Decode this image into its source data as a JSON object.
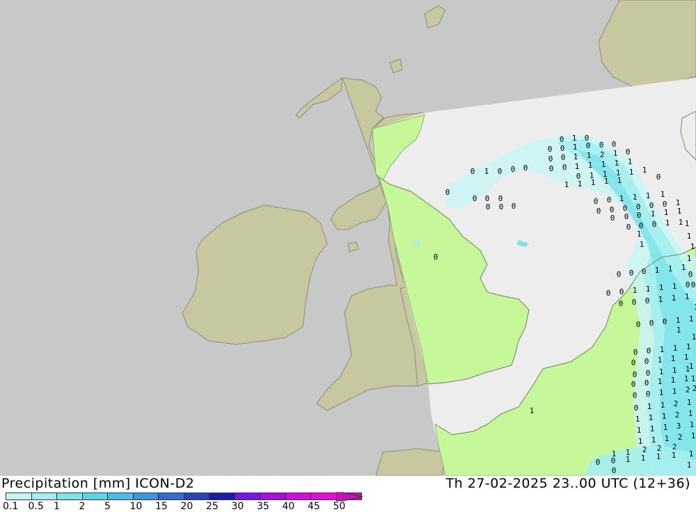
{
  "header": {
    "title_left": "Precipitation [mm] ICON-D2",
    "title_right": "Th 27-02-2025 23..00 UTC (12+36)"
  },
  "legend": {
    "labels": [
      "0.1",
      "0.5",
      "1",
      "2",
      "5",
      "10",
      "15",
      "20",
      "25",
      "30",
      "35",
      "40",
      "45",
      "50"
    ],
    "colors": [
      "#c8f4f4",
      "#a4eef0",
      "#7de4ea",
      "#5cd6e4",
      "#4cbde6",
      "#3c96de",
      "#2f6cd4",
      "#2744bc",
      "#1c1ca8",
      "#7a14e8",
      "#a80ce0",
      "#d60ae0",
      "#e80cd8",
      "#c414b4"
    ]
  },
  "colors": {
    "outside_domain": "#c8c8c8",
    "model_land": "#c8c8a0",
    "model_sea": "#ededed",
    "model_land_green": "#c6f89a",
    "precip_light": "#a4eef0",
    "precip_medium": "#7de4ea"
  },
  "map": {
    "values": [
      "0",
      "1",
      "0",
      "0",
      "0",
      "1",
      "0",
      "0",
      "0",
      "0",
      "0",
      "1",
      "1",
      "2",
      "1",
      "0",
      "0",
      "0",
      "1",
      "1",
      "1",
      "1",
      "1",
      "0",
      "1",
      "0",
      "0",
      "0",
      "0",
      "1",
      "1",
      "1",
      "1",
      "1",
      "0",
      "0",
      "0",
      "0",
      "1",
      "1",
      "1",
      "1",
      "1",
      "0",
      "0",
      "0",
      "0",
      "0",
      "0",
      "1",
      "1",
      "1",
      "1",
      "0",
      "0",
      "0",
      "0",
      "0",
      "0",
      "1",
      "1",
      "1",
      "1",
      "0",
      "0",
      "0",
      "1",
      "1",
      "1",
      "1",
      "0",
      "0",
      "0",
      "1",
      "1",
      "1",
      "1",
      "0",
      "0",
      "0",
      "1",
      "1",
      "1",
      "0",
      "0",
      "0",
      "0",
      "1",
      "1",
      "1",
      "1",
      "0",
      "0",
      "0",
      "0",
      "1",
      "1",
      "1",
      "0",
      "0",
      "0",
      "0",
      "1",
      "1",
      "1",
      "1",
      "0",
      "0",
      "1",
      "1",
      "1",
      "1",
      "0",
      "0",
      "1",
      "1",
      "1",
      "1",
      "0",
      "0",
      "1",
      "1",
      "1",
      "1",
      "0",
      "0",
      "1",
      "1",
      "1",
      "2",
      "0",
      "0",
      "1",
      "1",
      "2",
      "1",
      "0",
      "1",
      "1",
      "2",
      "1",
      "1",
      "1",
      "1",
      "2",
      "1",
      "1",
      "1",
      "1",
      "3",
      "1",
      "1",
      "1",
      "1",
      "2",
      "1",
      "1",
      "1",
      "2",
      "2",
      "2",
      "1",
      "0",
      "0",
      "1",
      "1",
      "1",
      "1",
      "1",
      "0",
      "0"
    ]
  }
}
